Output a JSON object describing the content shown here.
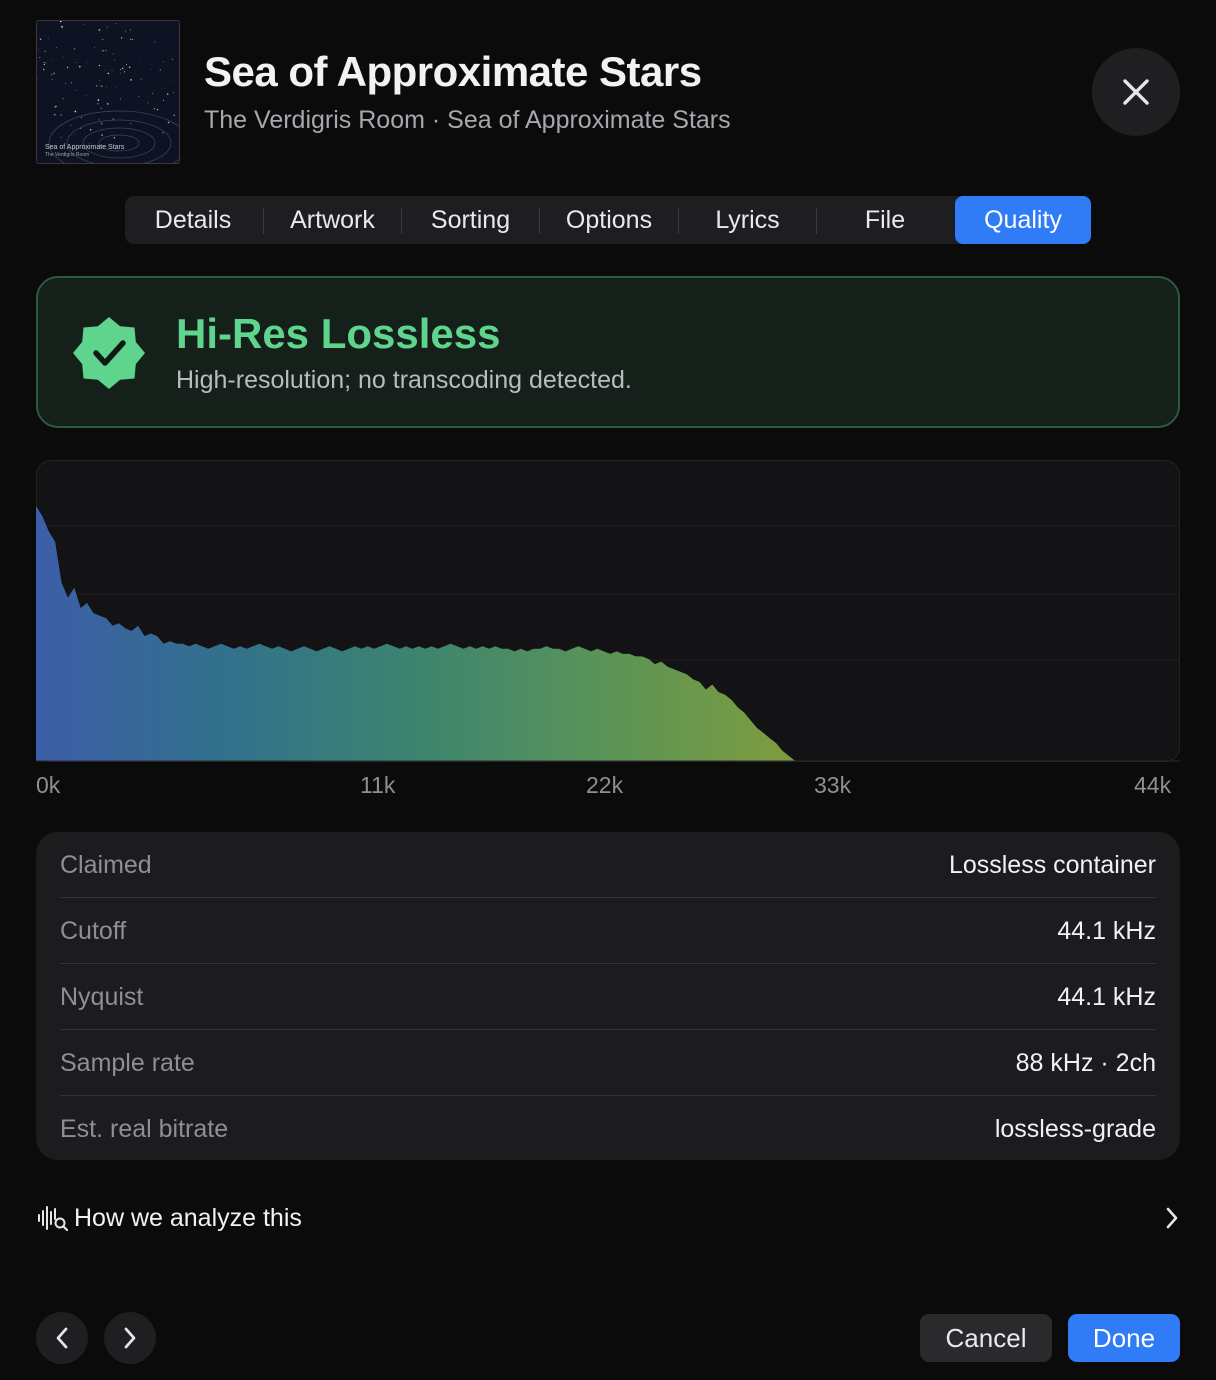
{
  "header": {
    "artwork_title": "Sea of Approximate Stars",
    "artwork_artist": "The Verdigris Room",
    "title": "Sea of Approximate Stars",
    "subtitle": "The Verdigris Room · Sea of Approximate Stars",
    "close_icon": "xmark-icon"
  },
  "tabs": [
    {
      "label": "Details",
      "active": false
    },
    {
      "label": "Artwork",
      "active": false
    },
    {
      "label": "Sorting",
      "active": false
    },
    {
      "label": "Options",
      "active": false
    },
    {
      "label": "Lyrics",
      "active": false
    },
    {
      "label": "File",
      "active": false
    },
    {
      "label": "Quality",
      "active": true
    }
  ],
  "verdict": {
    "icon": "checkmark-seal-icon",
    "title": "Hi-Res Lossless",
    "description": "High-resolution; no transcoding detected.",
    "color": "#5fd48d"
  },
  "spectrum": {
    "x_ticks": [
      "0k",
      "11k",
      "22k",
      "33k",
      "44k"
    ],
    "x_range": [
      0,
      44
    ],
    "cutoff_khz": 29.2,
    "profile": [
      1.0,
      0.96,
      0.9,
      0.86,
      0.7,
      0.64,
      0.68,
      0.6,
      0.62,
      0.58,
      0.57,
      0.56,
      0.53,
      0.54,
      0.52,
      0.51,
      0.53,
      0.49,
      0.5,
      0.49,
      0.46,
      0.47,
      0.46,
      0.46,
      0.45,
      0.46,
      0.45,
      0.44,
      0.45,
      0.46,
      0.45,
      0.44,
      0.45,
      0.44,
      0.45,
      0.46,
      0.45,
      0.44,
      0.45,
      0.44,
      0.43,
      0.44,
      0.45,
      0.44,
      0.43,
      0.44,
      0.45,
      0.44,
      0.43,
      0.44,
      0.45,
      0.44,
      0.45,
      0.44,
      0.45,
      0.46,
      0.45,
      0.44,
      0.45,
      0.44,
      0.45,
      0.44,
      0.45,
      0.44,
      0.45,
      0.46,
      0.45,
      0.44,
      0.45,
      0.44,
      0.45,
      0.44,
      0.45,
      0.44,
      0.44,
      0.43,
      0.44,
      0.43,
      0.44,
      0.44,
      0.45,
      0.44,
      0.44,
      0.43,
      0.44,
      0.45,
      0.44,
      0.43,
      0.44,
      0.43,
      0.42,
      0.43,
      0.42,
      0.42,
      0.41,
      0.41,
      0.4,
      0.38,
      0.39,
      0.37,
      0.36,
      0.35,
      0.34,
      0.32,
      0.31,
      0.28,
      0.3,
      0.27,
      0.26,
      0.24,
      0.21,
      0.19,
      0.16,
      0.13,
      0.11,
      0.09,
      0.07,
      0.04,
      0.02,
      0.0
    ],
    "gradient_colors": [
      "#3d5ea8",
      "#32718c",
      "#3d8470",
      "#5a9457",
      "#7f9c3e"
    ]
  },
  "stats": [
    {
      "key": "Claimed",
      "value": "Lossless container"
    },
    {
      "key": "Cutoff",
      "value": "44.1 kHz"
    },
    {
      "key": "Nyquist",
      "value": "44.1 kHz"
    },
    {
      "key": "Sample rate",
      "value": "88 kHz · 2ch"
    },
    {
      "key": "Est. real bitrate",
      "value": "lossless-grade"
    }
  ],
  "how_link": {
    "label": "How we analyze this",
    "icon": "waveform-magnifier-icon",
    "chevron": "chevron-right-icon"
  },
  "footer": {
    "prev_icon": "chevron-left-icon",
    "next_icon": "chevron-right-icon",
    "cancel_label": "Cancel",
    "done_label": "Done",
    "accent": "#2f7cf6"
  }
}
